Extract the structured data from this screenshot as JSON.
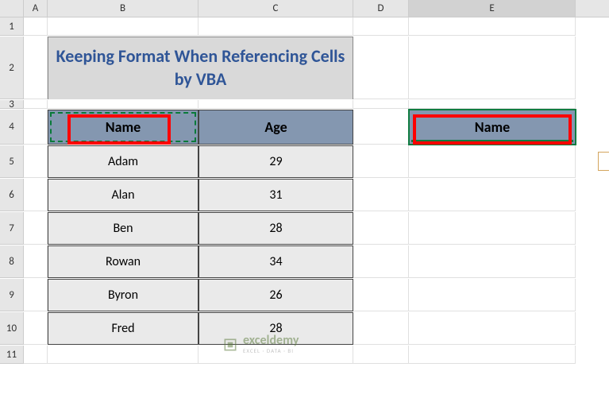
{
  "columns": [
    "A",
    "B",
    "C",
    "D",
    "E"
  ],
  "rows": [
    "1",
    "2",
    "3",
    "4",
    "5",
    "6",
    "7",
    "8",
    "9",
    "10",
    "11"
  ],
  "title": "Keeping Format When Referencing Cells by VBA",
  "table": {
    "headers": {
      "name": "Name",
      "age": "Age"
    },
    "data": [
      {
        "name": "Adam",
        "age": "29"
      },
      {
        "name": "Alan",
        "age": "31"
      },
      {
        "name": "Ben",
        "age": "28"
      },
      {
        "name": "Rowan",
        "age": "34"
      },
      {
        "name": "Byron",
        "age": "26"
      },
      {
        "name": "Fred",
        "age": "28"
      }
    ]
  },
  "pasted_cell": "Name",
  "watermark": {
    "brand": "exceldemy",
    "tag": "EXCEL · DATA · BI"
  },
  "chart_data": {
    "type": "table",
    "headers": [
      "Name",
      "Age"
    ],
    "rows": [
      [
        "Adam",
        29
      ],
      [
        "Alan",
        31
      ],
      [
        "Ben",
        28
      ],
      [
        "Rowan",
        34
      ],
      [
        "Byron",
        26
      ],
      [
        "Fred",
        28
      ]
    ],
    "title": "Keeping Format When Referencing Cells by VBA"
  }
}
